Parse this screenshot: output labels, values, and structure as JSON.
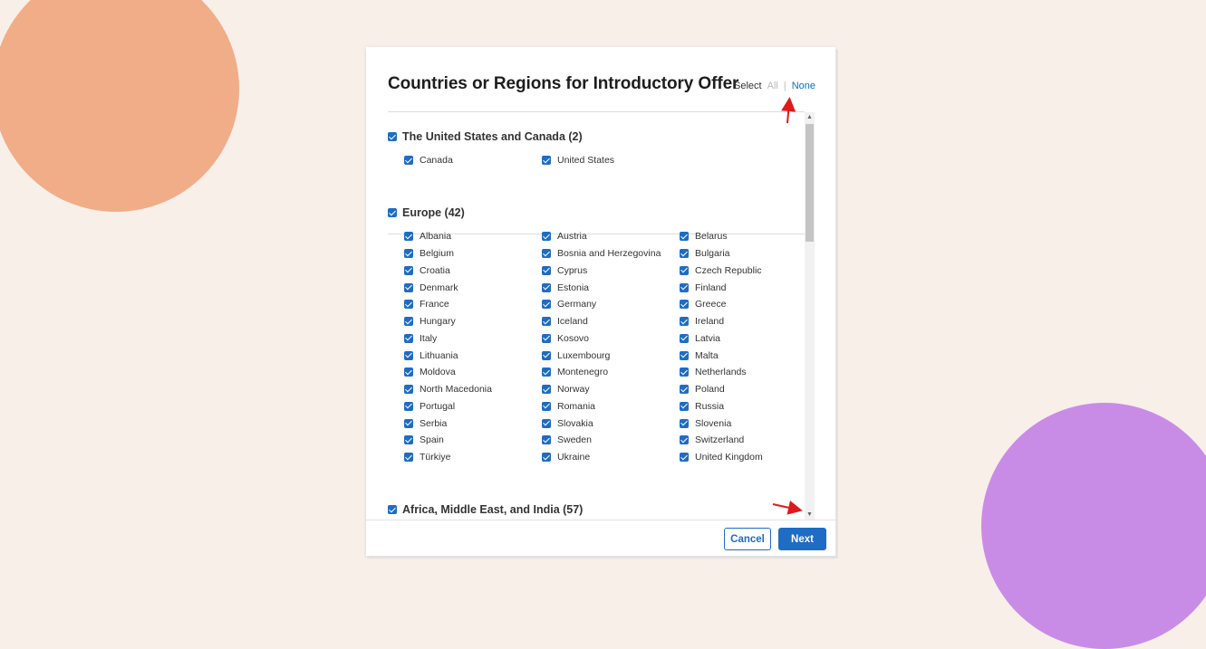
{
  "modal": {
    "title": "Countries or Regions for Introductory Offer",
    "select_label": "Select",
    "select_all": "All",
    "select_separator": "|",
    "select_none": "None"
  },
  "regions": [
    {
      "title": "The United States and Canada (2)",
      "checked": true,
      "countries": [
        "Canada",
        "United States"
      ]
    },
    {
      "title": "Europe (42)",
      "checked": true,
      "countries": [
        "Albania",
        "Austria",
        "Belarus",
        "Belgium",
        "Bosnia and Herzegovina",
        "Bulgaria",
        "Croatia",
        "Cyprus",
        "Czech Republic",
        "Denmark",
        "Estonia",
        "Finland",
        "France",
        "Germany",
        "Greece",
        "Hungary",
        "Iceland",
        "Ireland",
        "Italy",
        "Kosovo",
        "Latvia",
        "Lithuania",
        "Luxembourg",
        "Malta",
        "Moldova",
        "Montenegro",
        "Netherlands",
        "North Macedonia",
        "Norway",
        "Poland",
        "Portugal",
        "Romania",
        "Russia",
        "Serbia",
        "Slovakia",
        "Slovenia",
        "Spain",
        "Sweden",
        "Switzerland",
        "Türkiye",
        "Ukraine",
        "United Kingdom"
      ]
    },
    {
      "title": "Africa, Middle East, and India (57)",
      "checked": true,
      "countries": []
    }
  ],
  "footer": {
    "cancel_label": "Cancel",
    "next_label": "Next"
  },
  "colors": {
    "accent": "#1f6cc4",
    "link": "#0070c9",
    "annotation_arrow": "#e0191b",
    "blob_orange": "#f0ad88",
    "blob_purple": "#c98ce6"
  }
}
